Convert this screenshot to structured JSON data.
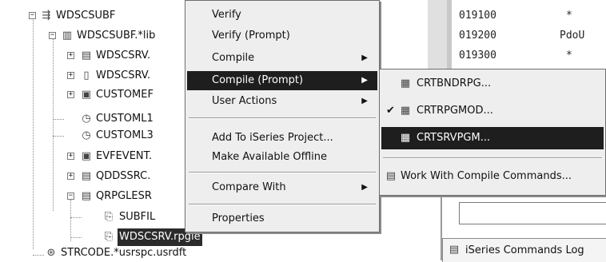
{
  "tree": {
    "items": [
      {
        "label": "WDSCSUBF",
        "icon": "connection-icon"
      },
      {
        "label": "WDSCSUBF.*lib",
        "icon": "library-icon"
      },
      {
        "label": "WDSCSRV.",
        "icon": "program-icon"
      },
      {
        "label": "WDSCSRV.",
        "icon": "module-icon"
      },
      {
        "label": "CUSTOMEF",
        "icon": "file-icon"
      },
      {
        "label": "CUSTOML1",
        "icon": "logical-file-icon"
      },
      {
        "label": "CUSTOML3",
        "icon": "logical-file-icon"
      },
      {
        "label": "EVFEVENT.",
        "icon": "file-icon"
      },
      {
        "label": "QDDSSRC.",
        "icon": "source-file-icon"
      },
      {
        "label": "QRPGLESR",
        "icon": "source-file-icon"
      },
      {
        "label": "SUBFIL",
        "icon": "member-icon"
      },
      {
        "label": "WDSCSRV.rpgle",
        "icon": "member-icon"
      },
      {
        "label": "STRCODE.*usrspc.usrdft",
        "icon": "user-space-icon"
      }
    ]
  },
  "editor": {
    "sequence_numbers": [
      "019100",
      "019200",
      "019300"
    ],
    "code": [
      "*",
      "PdoU",
      "*"
    ],
    "command_log_label": "iSeries Commands Log"
  },
  "context_menu": {
    "items": [
      {
        "label": "Verify",
        "submenu": false
      },
      {
        "label": "Verify (Prompt)",
        "submenu": false
      },
      {
        "label": "Compile",
        "submenu": true
      },
      {
        "label": "Compile (Prompt)",
        "submenu": true,
        "active": true
      },
      {
        "label": "User Actions",
        "submenu": true
      },
      {
        "label": "Add To iSeries Project...",
        "submenu": false
      },
      {
        "label": "Make Available Offline",
        "submenu": false
      },
      {
        "label": "Compare With",
        "submenu": true
      },
      {
        "label": "Properties",
        "submenu": false
      }
    ]
  },
  "submenu": {
    "items": [
      {
        "label": "CRTBNDRPG...",
        "checked": false
      },
      {
        "label": "CRTRPGMOD...",
        "checked": true
      },
      {
        "label": "CRTSRVPGM...",
        "checked": false,
        "active": true
      },
      {
        "label": "Work With Compile Commands...",
        "checked": false
      }
    ]
  },
  "glyphs": {
    "submenu_arrow": "▶",
    "checkmark": "✔",
    "expand_plus": "+",
    "expand_minus": "−"
  }
}
